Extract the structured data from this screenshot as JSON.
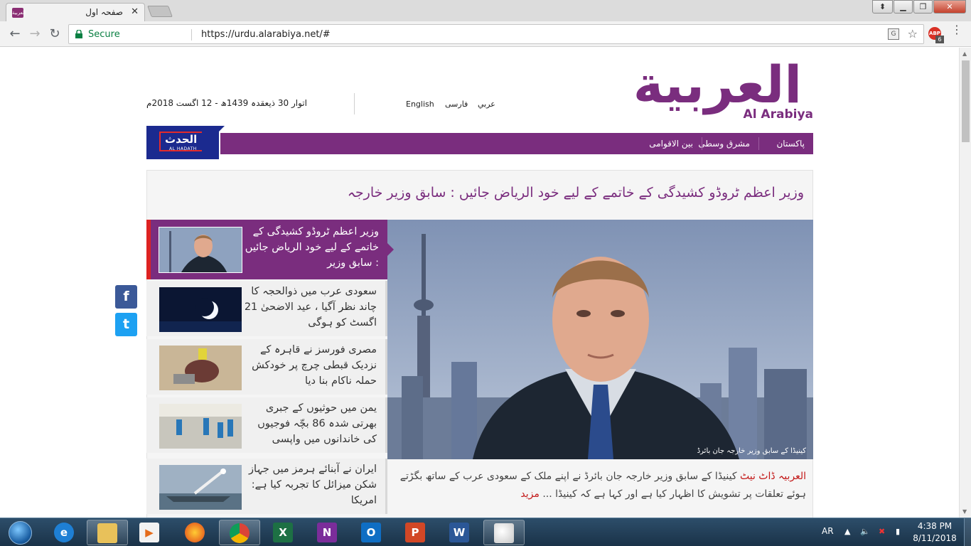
{
  "browser": {
    "tab_title": "صفحہ اول",
    "tab_favicon_text": "العربية",
    "secure_label": "Secure",
    "url": "https://urdu.alarabiya.net/#",
    "extension_badge": "6",
    "extension_text": "ABP"
  },
  "site": {
    "logo_arabic": "العربية",
    "logo_english": "Al Arabiya",
    "date": "اتوار 30 ذیعقدہ 1439ھ - 12 اگست 2018م",
    "languages": [
      "عربي",
      "فارسی",
      "English"
    ],
    "alhadath_ar": "الحدث",
    "alhadath_en": "AL HADATH",
    "nav": [
      "پاکستان",
      "مشرق وسطی",
      "بین الاقوامی"
    ]
  },
  "main": {
    "headline": "وزیر اعظم ٹروڈو کشیدگی کے خاتمے کے لیے خود الریاض جائیں : سابق وزیر خارجہ",
    "hero_caption": "کینیڈا کے سابق وزیر خارجہ جان بائرڈ",
    "summary_source": "العربیہ ڈاٹ نیٹ",
    "summary_text": "کینیڈا کے سابق وزیر خارجہ جان بائرڈ نے اپنے ملک کے سعودی عرب کے ساتھ بگڑتے ہوئے تعلقات پر تشویش کا اظہار کیا ہے اور کہا ہے کہ کینیڈا ...",
    "summary_more": "مزید"
  },
  "stories": [
    {
      "title": "وزیر اعظم ٹروڈو کشیدگی کے خاتمے کے لیے خود الریاض جائیں : سابق وزیر",
      "active": true
    },
    {
      "title": "سعودی عرب میں ذوالحجہ کا چاند نظر آگیا ، عید الاضحیٰ 21 اگسٹ کو ہوگی",
      "active": false
    },
    {
      "title": "مصری فورسز نے قاہرہ کے نزدیک قبطی چرچ پر خودکش حملہ ناکام بنا دیا",
      "active": false
    },
    {
      "title": "یمن میں حوثیوں کے جبری بھرتی شدہ 86 بچّہ فوجیوں کی خاندانوں میں واپسی",
      "active": false
    },
    {
      "title": "ایران نے آبنائے ہرمز میں جہاز شکن میزائل کا تجربہ کیا ہے: امریکا",
      "active": false
    }
  ],
  "share": {
    "facebook": "f",
    "twitter": "t"
  },
  "taskbar": {
    "apps": [
      "ie",
      "explorer",
      "media-player",
      "firefox",
      "chrome",
      "excel",
      "onenote",
      "outlook",
      "powerpoint",
      "word",
      "paint"
    ],
    "language": "AR",
    "time": "4:38 PM",
    "date": "8/11/2018"
  },
  "colors": {
    "brand": "#7a2d7e",
    "accent_red": "#c31919",
    "alhadath_blue": "#1b2a8f"
  }
}
